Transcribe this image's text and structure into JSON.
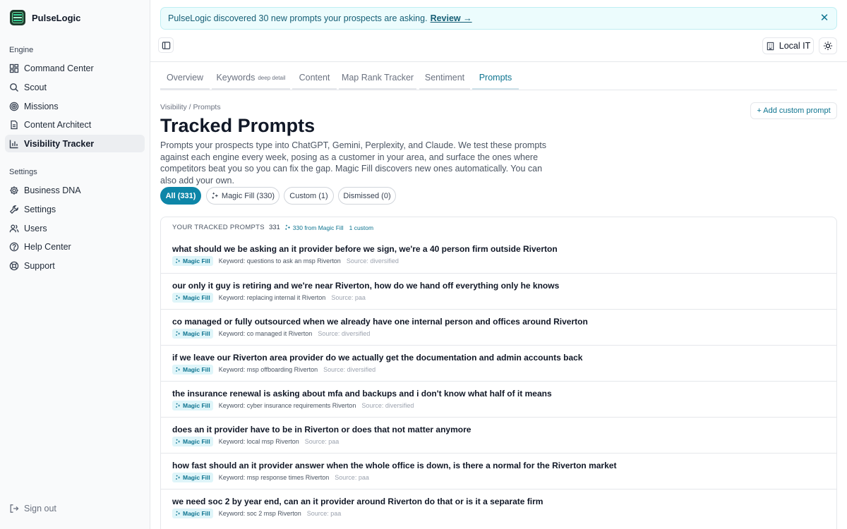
{
  "app": {
    "name": "PulseLogic"
  },
  "sidebar": {
    "engine_label": "Engine",
    "engine_items": [
      {
        "label": "Command Center",
        "icon": "grid-icon"
      },
      {
        "label": "Scout",
        "icon": "search-icon"
      },
      {
        "label": "Missions",
        "icon": "target-icon"
      },
      {
        "label": "Content Architect",
        "icon": "document-icon"
      },
      {
        "label": "Visibility Tracker",
        "icon": "bar-chart-icon"
      }
    ],
    "settings_label": "Settings",
    "settings_items": [
      {
        "label": "Business DNA",
        "icon": "gear-icon"
      },
      {
        "label": "Settings",
        "icon": "wrench-icon"
      },
      {
        "label": "Users",
        "icon": "users-icon"
      },
      {
        "label": "Help Center",
        "icon": "help-circle-icon"
      },
      {
        "label": "Support",
        "icon": "lifebuoy-icon"
      }
    ],
    "signout": "Sign out"
  },
  "banner": {
    "text": "PulseLogic discovered 30 new prompts your prospects are asking.",
    "link": "Review →"
  },
  "topbar": {
    "workspace": "Local IT"
  },
  "tabs": [
    {
      "label": "Overview"
    },
    {
      "label": "Keywords",
      "sub": "deep detail"
    },
    {
      "label": "Content"
    },
    {
      "label": "Map Rank Tracker"
    },
    {
      "label": "Sentiment"
    },
    {
      "label": "Prompts"
    }
  ],
  "header": {
    "breadcrumb": "Visibility / Prompts",
    "title": "Tracked Prompts",
    "description": "Prompts your prospects type into ChatGPT, Gemini, Perplexity, and Claude. We test these prompts against each engine every week, posing as a customer in your area, and surface the ones where competitors beat you so you can fix the gap. Magic Fill discovers new ones automatically. You can also add your own.",
    "add_button": "+ Add custom prompt"
  },
  "filters": [
    {
      "label": "All (331)"
    },
    {
      "label": "Magic Fill (330)"
    },
    {
      "label": "Custom (1)"
    },
    {
      "label": "Dismissed (0)"
    }
  ],
  "list": {
    "title": "YOUR TRACKED PROMPTS",
    "count": "331",
    "magic_count": "330 from Magic Fill",
    "custom_count": "1 custom",
    "rows": [
      {
        "question": "what should we be asking an it provider before we sign, we're a 40 person firm outside Riverton",
        "badge": "Magic Fill",
        "keyword": "Keyword: questions to ask an msp Riverton",
        "source": "Source: diversified"
      },
      {
        "question": "our only it guy is retiring and we're near Riverton, how do we hand off everything only he knows",
        "badge": "Magic Fill",
        "keyword": "Keyword: replacing internal it Riverton",
        "source": "Source: paa"
      },
      {
        "question": "co managed or fully outsourced when we already have one internal person and offices around Riverton",
        "badge": "Magic Fill",
        "keyword": "Keyword: co managed it Riverton",
        "source": "Source: diversified"
      },
      {
        "question": "if we leave our Riverton area provider do we actually get the documentation and admin accounts back",
        "badge": "Magic Fill",
        "keyword": "Keyword: msp offboarding Riverton",
        "source": "Source: diversified"
      },
      {
        "question": "the insurance renewal is asking about mfa and backups and i don't know what half of it means",
        "badge": "Magic Fill",
        "keyword": "Keyword: cyber insurance requirements Riverton",
        "source": "Source: diversified"
      },
      {
        "question": "does an it provider have to be in Riverton or does that not matter anymore",
        "badge": "Magic Fill",
        "keyword": "Keyword: local msp Riverton",
        "source": "Source: paa"
      },
      {
        "question": "how fast should an it provider answer when the whole office is down, is there a normal for the Riverton market",
        "badge": "Magic Fill",
        "keyword": "Keyword: msp response times Riverton",
        "source": "Source: paa"
      },
      {
        "question": "we need soc 2 by year end, can an it provider around Riverton do that or is it a separate firm",
        "badge": "Magic Fill",
        "keyword": "Keyword: soc 2 msp Riverton",
        "source": "Source: paa"
      }
    ]
  },
  "colors": {
    "accent": "#0e86a8",
    "accent_text": "#0e7490",
    "banner_bg": "#ecfcfd"
  }
}
